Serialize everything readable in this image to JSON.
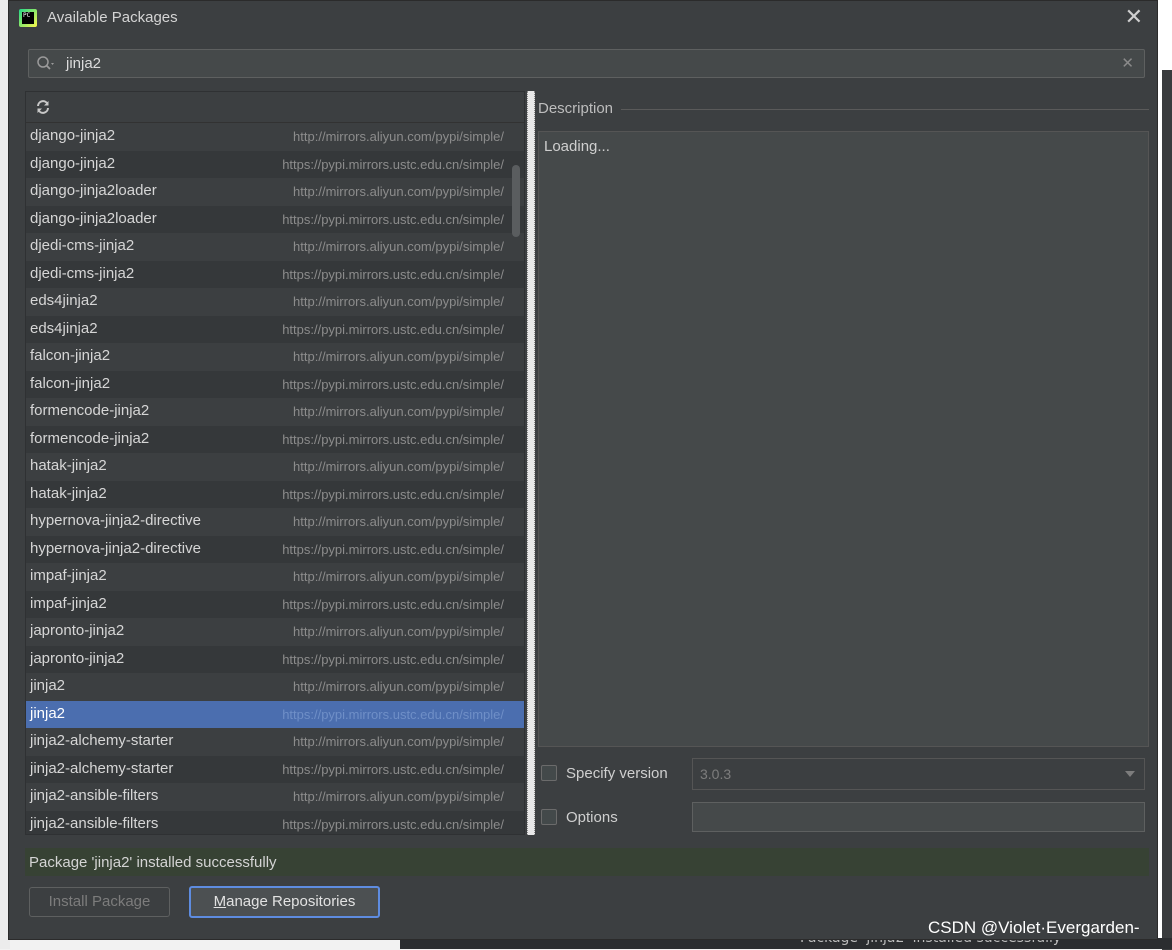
{
  "window": {
    "title": "Available Packages",
    "app_icon": "PC"
  },
  "search": {
    "value": "jinja2"
  },
  "packages": [
    {
      "name": "django-jinja2",
      "repo": "http://mirrors.aliyun.com/pypi/simple/"
    },
    {
      "name": "django-jinja2",
      "repo": "https://pypi.mirrors.ustc.edu.cn/simple/"
    },
    {
      "name": "django-jinja2loader",
      "repo": "http://mirrors.aliyun.com/pypi/simple/"
    },
    {
      "name": "django-jinja2loader",
      "repo": "https://pypi.mirrors.ustc.edu.cn/simple/"
    },
    {
      "name": "djedi-cms-jinja2",
      "repo": "http://mirrors.aliyun.com/pypi/simple/"
    },
    {
      "name": "djedi-cms-jinja2",
      "repo": "https://pypi.mirrors.ustc.edu.cn/simple/"
    },
    {
      "name": "eds4jinja2",
      "repo": "http://mirrors.aliyun.com/pypi/simple/"
    },
    {
      "name": "eds4jinja2",
      "repo": "https://pypi.mirrors.ustc.edu.cn/simple/"
    },
    {
      "name": "falcon-jinja2",
      "repo": "http://mirrors.aliyun.com/pypi/simple/"
    },
    {
      "name": "falcon-jinja2",
      "repo": "https://pypi.mirrors.ustc.edu.cn/simple/"
    },
    {
      "name": "formencode-jinja2",
      "repo": "http://mirrors.aliyun.com/pypi/simple/"
    },
    {
      "name": "formencode-jinja2",
      "repo": "https://pypi.mirrors.ustc.edu.cn/simple/"
    },
    {
      "name": "hatak-jinja2",
      "repo": "http://mirrors.aliyun.com/pypi/simple/"
    },
    {
      "name": "hatak-jinja2",
      "repo": "https://pypi.mirrors.ustc.edu.cn/simple/"
    },
    {
      "name": "hypernova-jinja2-directive",
      "repo": "http://mirrors.aliyun.com/pypi/simple/"
    },
    {
      "name": "hypernova-jinja2-directive",
      "repo": "https://pypi.mirrors.ustc.edu.cn/simple/"
    },
    {
      "name": "impaf-jinja2",
      "repo": "http://mirrors.aliyun.com/pypi/simple/"
    },
    {
      "name": "impaf-jinja2",
      "repo": "https://pypi.mirrors.ustc.edu.cn/simple/"
    },
    {
      "name": "japronto-jinja2",
      "repo": "http://mirrors.aliyun.com/pypi/simple/"
    },
    {
      "name": "japronto-jinja2",
      "repo": "https://pypi.mirrors.ustc.edu.cn/simple/"
    },
    {
      "name": "jinja2",
      "repo": "http://mirrors.aliyun.com/pypi/simple/"
    },
    {
      "name": "jinja2",
      "repo": "https://pypi.mirrors.ustc.edu.cn/simple/",
      "selected": true
    },
    {
      "name": "jinja2-alchemy-starter",
      "repo": "http://mirrors.aliyun.com/pypi/simple/"
    },
    {
      "name": "jinja2-alchemy-starter",
      "repo": "https://pypi.mirrors.ustc.edu.cn/simple/"
    },
    {
      "name": "jinja2-ansible-filters",
      "repo": "http://mirrors.aliyun.com/pypi/simple/"
    },
    {
      "name": "jinja2-ansible-filters",
      "repo": "https://pypi.mirrors.ustc.edu.cn/simple/"
    }
  ],
  "description": {
    "label": "Description",
    "content": "Loading..."
  },
  "specify_version": {
    "label": "Specify version",
    "value": "3.0.3",
    "checked": false
  },
  "options": {
    "label": "Options",
    "value": "",
    "checked": false
  },
  "status": {
    "message": "Package 'jinja2' installed successfully"
  },
  "buttons": {
    "install": "Install Package",
    "manage_mnemonic": "M",
    "manage_rest": "anage Repositories"
  },
  "background": {
    "bottom_text": "Package 'jinja2' installed successfully"
  },
  "watermark": "CSDN @Violet·Evergarden-",
  "colors": {
    "selection": "#4b6eaf",
    "status_bg": "#374234",
    "focus_border": "#5e8ce0"
  }
}
